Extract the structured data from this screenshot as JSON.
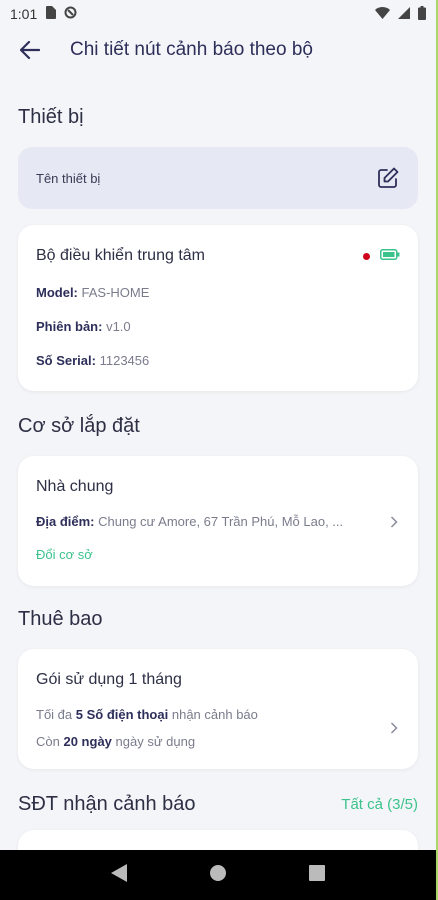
{
  "status_bar": {
    "time": "1:01"
  },
  "header": {
    "title": "Chi tiết nút cảnh báo theo bộ"
  },
  "device_section": {
    "title": "Thiết bị",
    "name_field_label": "Tên thiết bị",
    "card": {
      "title": "Bộ điều khiển trung tâm",
      "status_dot_color": "#d0021b",
      "battery_color": "#3cc38c",
      "model_label": "Model:",
      "model_value": "FAS-HOME",
      "version_label": "Phiên bản:",
      "version_value": "v1.0",
      "serial_label": "Số Serial:",
      "serial_value": "1123456"
    }
  },
  "location_section": {
    "title": "Cơ sở lắp đặt",
    "card": {
      "title": "Nhà chung",
      "address_label": "Địa điểm:",
      "address_value": "Chung cư Amore, 67 Trần Phú, Mỗ Lao, ...",
      "change_link": "Đổi cơ sở"
    }
  },
  "subscription_section": {
    "title": "Thuê bao",
    "card": {
      "title": "Gói sử dụng 1 tháng",
      "line1_prefix": "Tối đa",
      "line1_bold": "5 Số điện thoại",
      "line1_suffix": "nhận cảnh báo",
      "line2_prefix": "Còn",
      "line2_bold": "20 ngày",
      "line2_suffix": "ngày sử dụng"
    }
  },
  "phone_section": {
    "title": "SĐT nhận cảnh báo",
    "all_link": "Tất cả (3/5)"
  },
  "colors": {
    "accent_green": "#3cc38c",
    "title_navy": "#2d2f5a",
    "field_bg": "#e6e8f4"
  }
}
